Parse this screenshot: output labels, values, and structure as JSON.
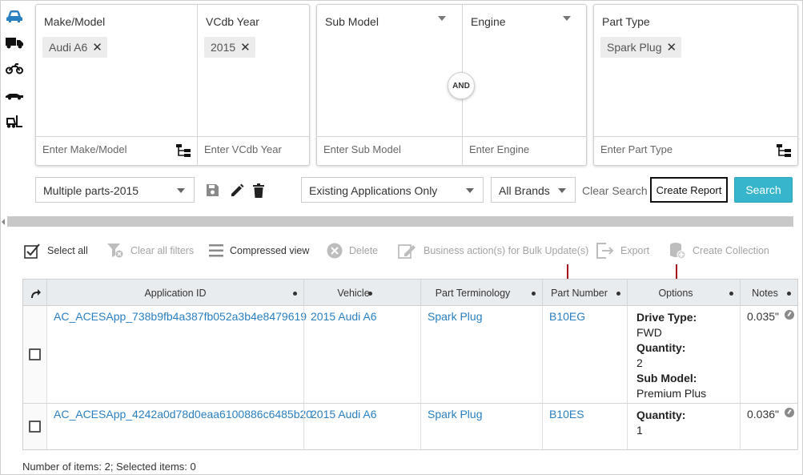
{
  "filters": {
    "make_model": {
      "title": "Make/Model",
      "chip": "Audi A6",
      "placeholder": "Enter Make/Model"
    },
    "vcdb_year": {
      "title": "VCdb Year",
      "chip": "2015",
      "placeholder": "Enter VCdb Year"
    },
    "sub_model": {
      "title": "Sub Model",
      "placeholder": "Enter Sub Model"
    },
    "engine": {
      "title": "Engine",
      "placeholder": "Enter Engine"
    },
    "and_label": "AND",
    "part_type": {
      "title": "Part Type",
      "chip": "Spark Plug",
      "placeholder": "Enter Part Type"
    },
    "chip_remove": "✕"
  },
  "controls": {
    "saved_search": "Multiple parts-2015",
    "application_filter": "Existing Applications Only",
    "brands": "All Brands",
    "clear_search": "Clear Search",
    "create_report": "Create Report",
    "search": "Search"
  },
  "toolbar": {
    "select_all": "Select all",
    "clear_filters": "Clear all filters",
    "compressed_view": "Compressed view",
    "delete": "Delete",
    "business_action": "Business action(s) for Bulk Update(s)",
    "export": "Export",
    "create_collection": "Create Collection"
  },
  "grid": {
    "columns": [
      "Application ID",
      "Vehicle",
      "Part Terminology",
      "Part Number",
      "Options",
      "Notes"
    ],
    "rows": [
      {
        "app_id": "AC_ACESApp_738b9fb4a387fb052a3b4e8479619",
        "vehicle": "2015 Audi A6",
        "part_terminology": "Spark Plug",
        "part_number": "B10EG",
        "options": [
          {
            "key": "Drive Type:",
            "value": "FWD"
          },
          {
            "key": "Quantity:",
            "value": "2"
          },
          {
            "key": "Sub Model:",
            "value": "Premium Plus"
          }
        ],
        "notes": "0.035\""
      },
      {
        "app_id": "AC_ACESApp_4242a0d78d0eaa6100886c6485b20",
        "vehicle": "2015 Audi A6",
        "part_terminology": "Spark Plug",
        "part_number": "B10ES",
        "options": [
          {
            "key": "Quantity:",
            "value": "1"
          }
        ],
        "notes": "0.036\""
      }
    ]
  },
  "footer": "Number of items: 2; Selected items: 0",
  "colors": {
    "accent": "#37b5cc",
    "link": "#2a7fc0",
    "annotation_arrow": "#a3121a",
    "active_vehicle_icon": "#2a7fc0"
  },
  "icons": [
    "car-icon",
    "truck-icon",
    "motorcycle-icon",
    "race-car-icon",
    "forklift-icon",
    "tree-view-icon",
    "save-icon",
    "edit-icon",
    "trash-icon"
  ]
}
